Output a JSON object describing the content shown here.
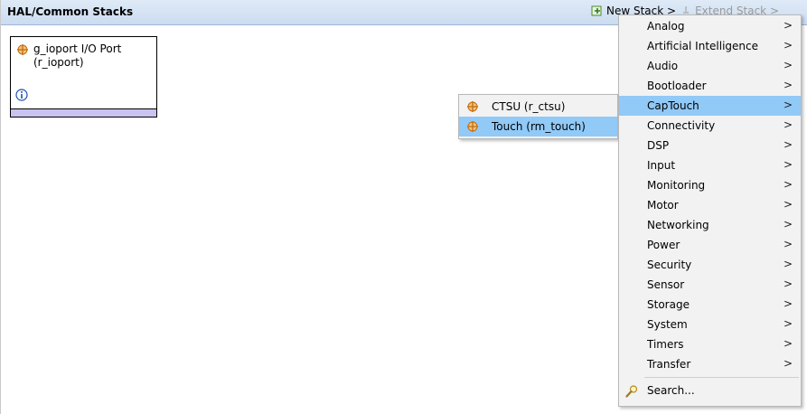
{
  "header": {
    "title": "HAL/Common Stacks",
    "new_stack_label": "New Stack >",
    "extend_stack_label": "Extend Stack >"
  },
  "module": {
    "name": "g_ioport I/O Port",
    "subname": "(r_ioport)"
  },
  "submenu": {
    "items": [
      {
        "label": "CTSU (r_ctsu)",
        "selected": false
      },
      {
        "label": "Touch (rm_touch)",
        "selected": true
      }
    ]
  },
  "menu": {
    "items": [
      {
        "label": "Analog"
      },
      {
        "label": "Artificial Intelligence"
      },
      {
        "label": "Audio"
      },
      {
        "label": "Bootloader"
      },
      {
        "label": "CapTouch",
        "selected": true
      },
      {
        "label": "Connectivity"
      },
      {
        "label": "DSP"
      },
      {
        "label": "Input"
      },
      {
        "label": "Monitoring"
      },
      {
        "label": "Motor"
      },
      {
        "label": "Networking"
      },
      {
        "label": "Power"
      },
      {
        "label": "Security"
      },
      {
        "label": "Sensor"
      },
      {
        "label": "Storage"
      },
      {
        "label": "System"
      },
      {
        "label": "Timers"
      },
      {
        "label": "Transfer"
      }
    ],
    "search_label": "Search...",
    "chevron": ">"
  },
  "colors": {
    "header_bg": "#cbdcf0",
    "selection": "#91c9f7",
    "module_bar": "#c9c3f0",
    "component_icon": "#d07a1a"
  }
}
